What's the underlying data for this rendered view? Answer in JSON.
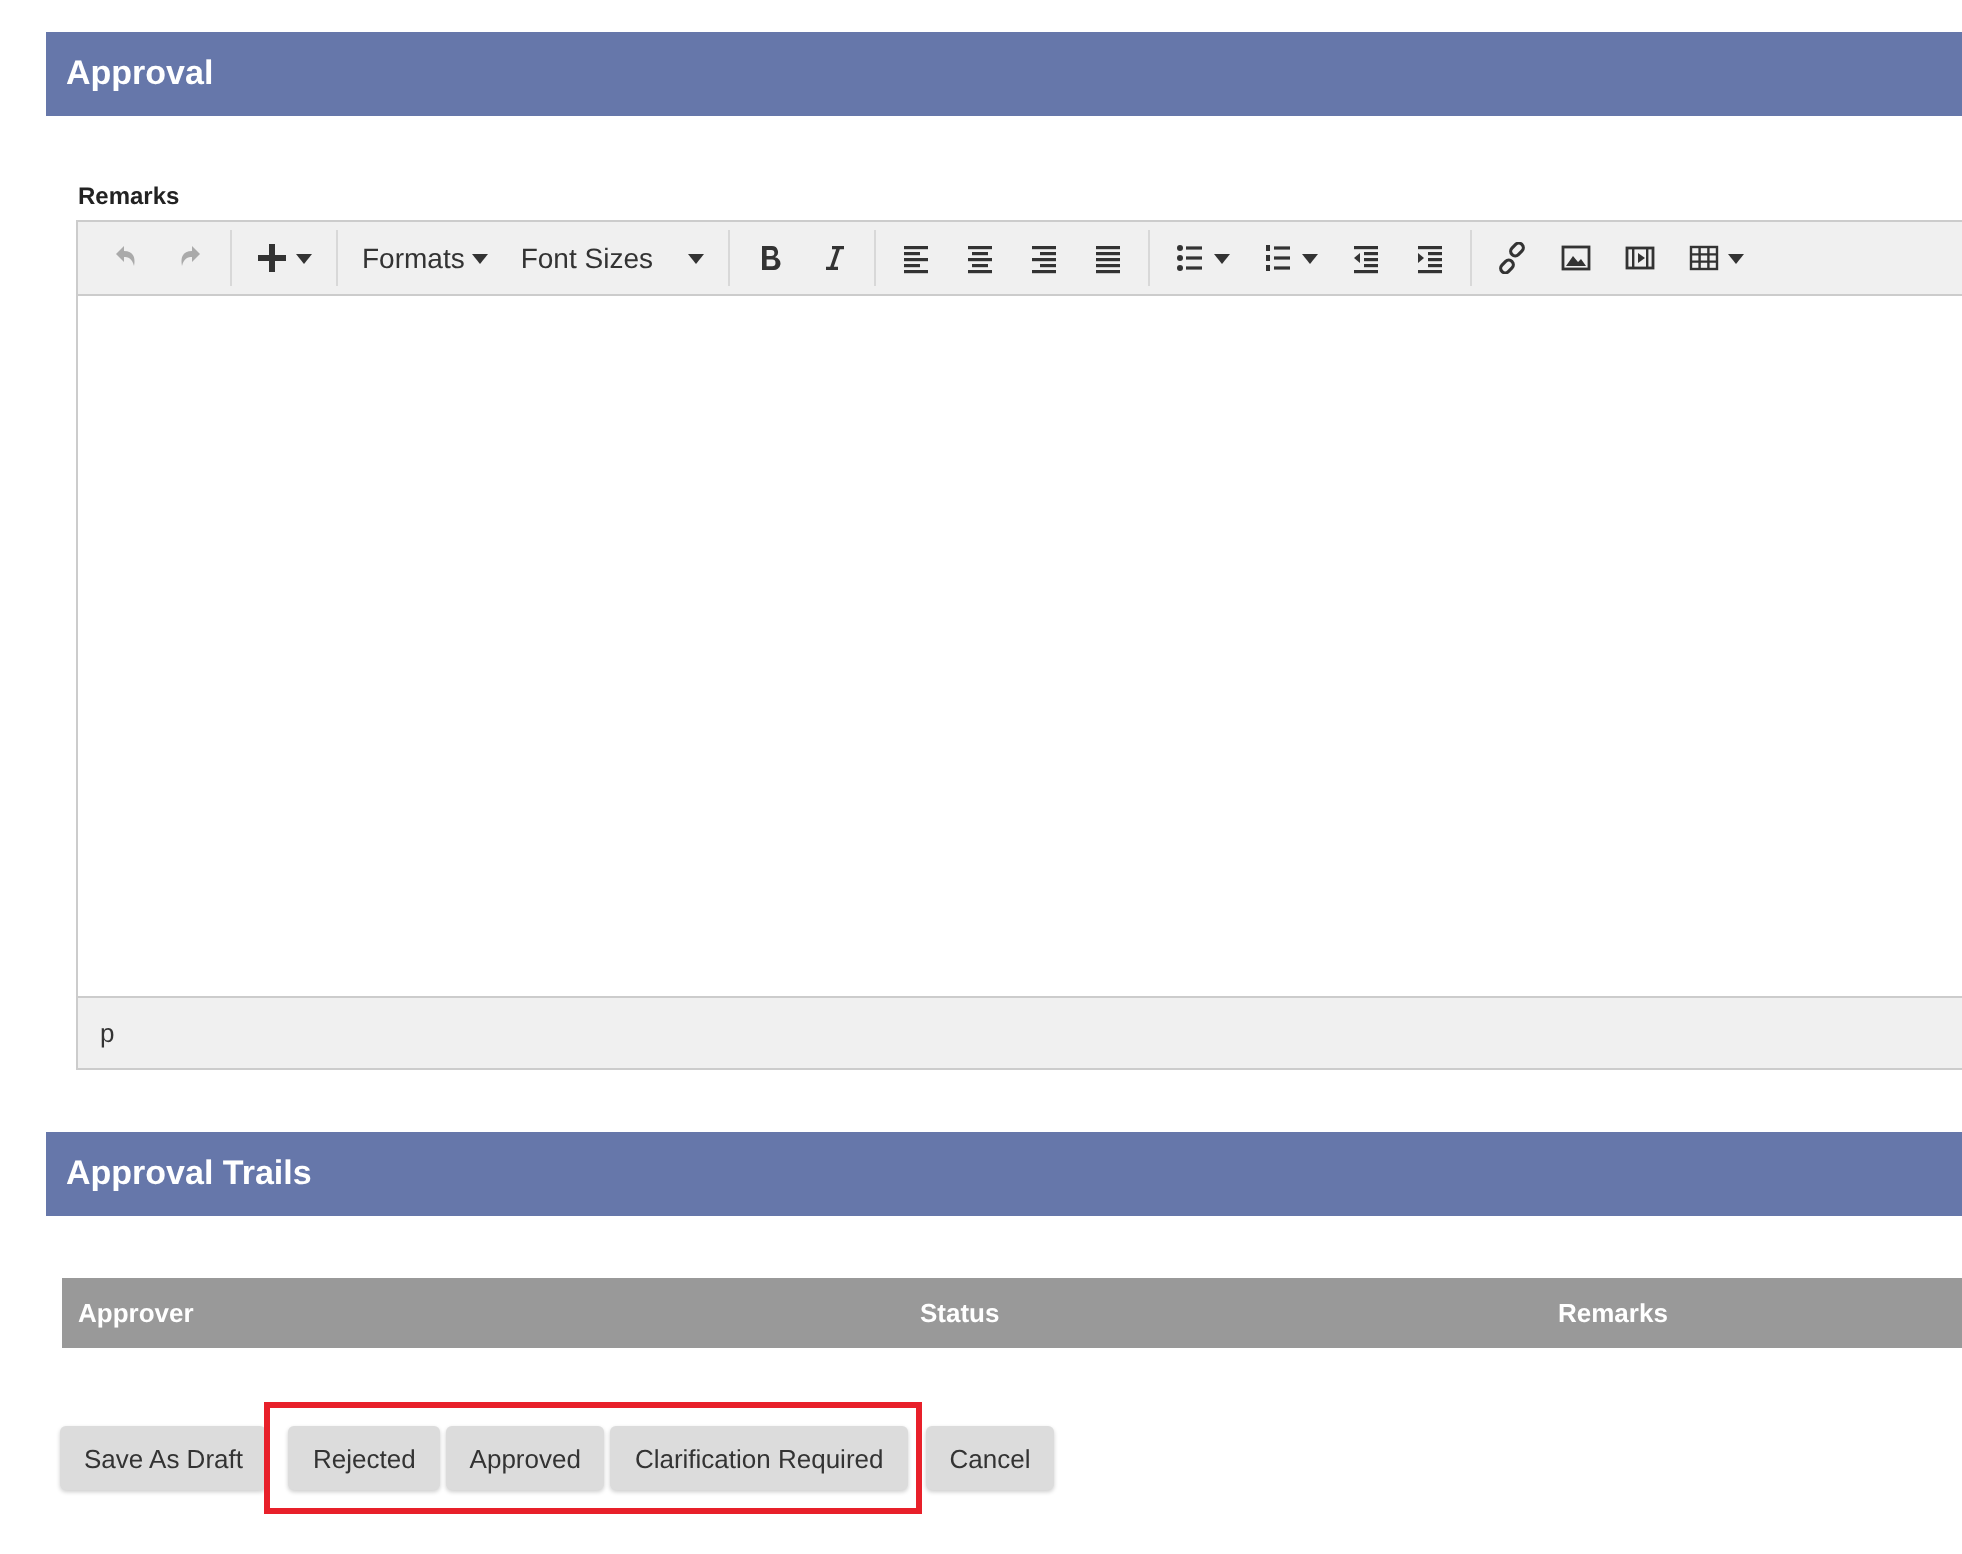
{
  "approval": {
    "title": "Approval",
    "remarks_label": "Remarks",
    "toolbar": [
      [
        {
          "kind": "undo",
          "disabled": true
        },
        {
          "kind": "redo",
          "disabled": true
        }
      ],
      [
        {
          "kind": "plus",
          "dropdown": true,
          "disabled": false
        }
      ],
      [
        {
          "kind": "text",
          "label": "Formats",
          "dropdown": true,
          "disabled": false
        },
        {
          "kind": "text",
          "label": "Font Sizes",
          "dropdown": true,
          "wide": true,
          "disabled": false
        }
      ],
      [
        {
          "kind": "bold",
          "disabled": false
        },
        {
          "kind": "italic",
          "disabled": false
        }
      ],
      [
        {
          "kind": "align-left",
          "disabled": false
        },
        {
          "kind": "align-center",
          "disabled": false
        },
        {
          "kind": "align-right",
          "disabled": false
        },
        {
          "kind": "justify",
          "disabled": false
        }
      ],
      [
        {
          "kind": "bullets",
          "dropdown": true,
          "disabled": false
        },
        {
          "kind": "numbers",
          "dropdown": true,
          "disabled": false
        },
        {
          "kind": "outdent",
          "disabled": false
        },
        {
          "kind": "indent",
          "disabled": false
        }
      ],
      [
        {
          "kind": "link",
          "disabled": false
        },
        {
          "kind": "image",
          "disabled": false
        },
        {
          "kind": "media",
          "disabled": false
        },
        {
          "kind": "table",
          "dropdown": true,
          "disabled": false
        }
      ]
    ],
    "status_path": "p"
  },
  "trails": {
    "title": "Approval Trails",
    "columns": [
      "Approver",
      "Status",
      "Remarks"
    ]
  },
  "buttons": [
    {
      "kind": "button",
      "label": "Save As Draft"
    },
    {
      "kind": "highlight_frame",
      "buttons": [
        {
          "label": "Rejected"
        },
        {
          "label": "Approved"
        },
        {
          "label": "Clarification Required"
        }
      ]
    },
    {
      "kind": "button",
      "label": "Cancel"
    }
  ]
}
